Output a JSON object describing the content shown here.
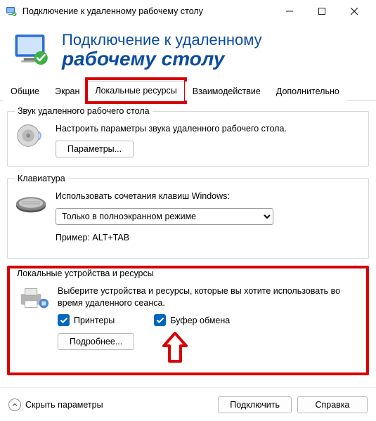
{
  "window": {
    "title": "Подключение к удаленному рабочему столу"
  },
  "header": {
    "line1": "Подключение к удаленному",
    "line2": "рабочему столу"
  },
  "tabs": {
    "general": "Общие",
    "display": "Экран",
    "local": "Локальные ресурсы",
    "experience": "Взаимодействие",
    "advanced": "Дополнительно"
  },
  "audio": {
    "legend": "Звук удаленного рабочего стола",
    "desc": "Настроить параметры звука удаленного рабочего стола.",
    "settings_btn": "Параметры..."
  },
  "keyboard": {
    "legend": "Клавиатура",
    "desc": "Использовать сочетания клавиш Windows:",
    "selected": "Только в полноэкранном режиме",
    "example": "Пример: ALT+TAB"
  },
  "devices": {
    "legend": "Локальные устройства и ресурсы",
    "desc": "Выберите устройства и ресурсы, которые вы хотите использовать во время удаленного сеанса.",
    "printers": "Принтеры",
    "clipboard": "Буфер обмена",
    "more_btn": "Подробнее..."
  },
  "footer": {
    "hide": "Скрыть параметры",
    "connect": "Подключить",
    "help": "Справка"
  }
}
